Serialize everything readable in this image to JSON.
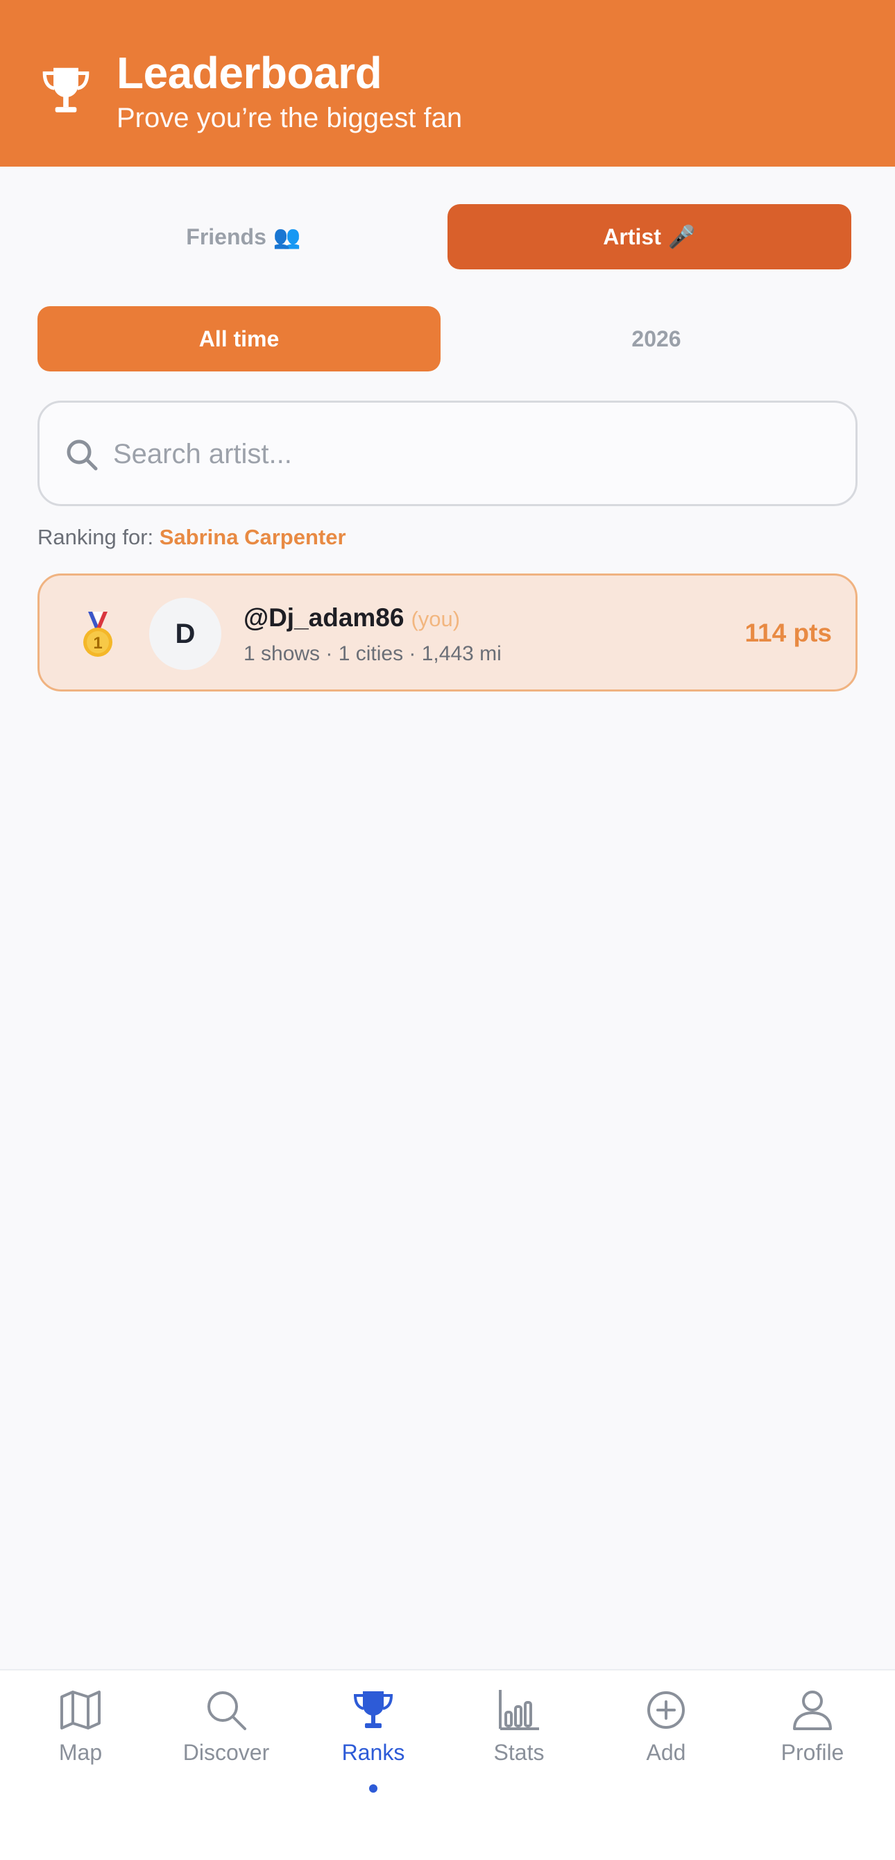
{
  "header": {
    "title": "Leaderboard",
    "subtitle": "Prove you’re the biggest fan"
  },
  "scope_tabs": [
    {
      "label": "Friends",
      "emoji": "👥",
      "active": false
    },
    {
      "label": "Artist",
      "emoji": "🎤",
      "active": true
    }
  ],
  "period_tabs": [
    {
      "label": "All time",
      "active": true
    },
    {
      "label": "2026",
      "active": false
    }
  ],
  "search": {
    "placeholder": "Search artist...",
    "value": ""
  },
  "ranking_for": {
    "prefix": "Ranking for:",
    "artist": "Sabrina Carpenter"
  },
  "leaderboard": [
    {
      "rank_icon": "gold-medal-icon",
      "avatar_initial": "D",
      "username": "@Dj_adam86",
      "you_label": "(you)",
      "stats": "1 shows · 1 cities · 1,443 mi",
      "points": "114 pts"
    }
  ],
  "nav": [
    {
      "label": "Map",
      "icon": "map-icon",
      "active": false
    },
    {
      "label": "Discover",
      "icon": "search-icon",
      "active": false
    },
    {
      "label": "Ranks",
      "icon": "trophy-icon",
      "active": true
    },
    {
      "label": "Stats",
      "icon": "bar-chart-icon",
      "active": false
    },
    {
      "label": "Add",
      "icon": "plus-circle-icon",
      "active": false
    },
    {
      "label": "Profile",
      "icon": "user-icon",
      "active": false
    }
  ],
  "colors": {
    "header_bg": "#ea7c37",
    "artist_tab_bg": "#d9602b",
    "accent": "#e88a43",
    "nav_active": "#2d5bd7",
    "row_bg": "#f9e6db"
  }
}
